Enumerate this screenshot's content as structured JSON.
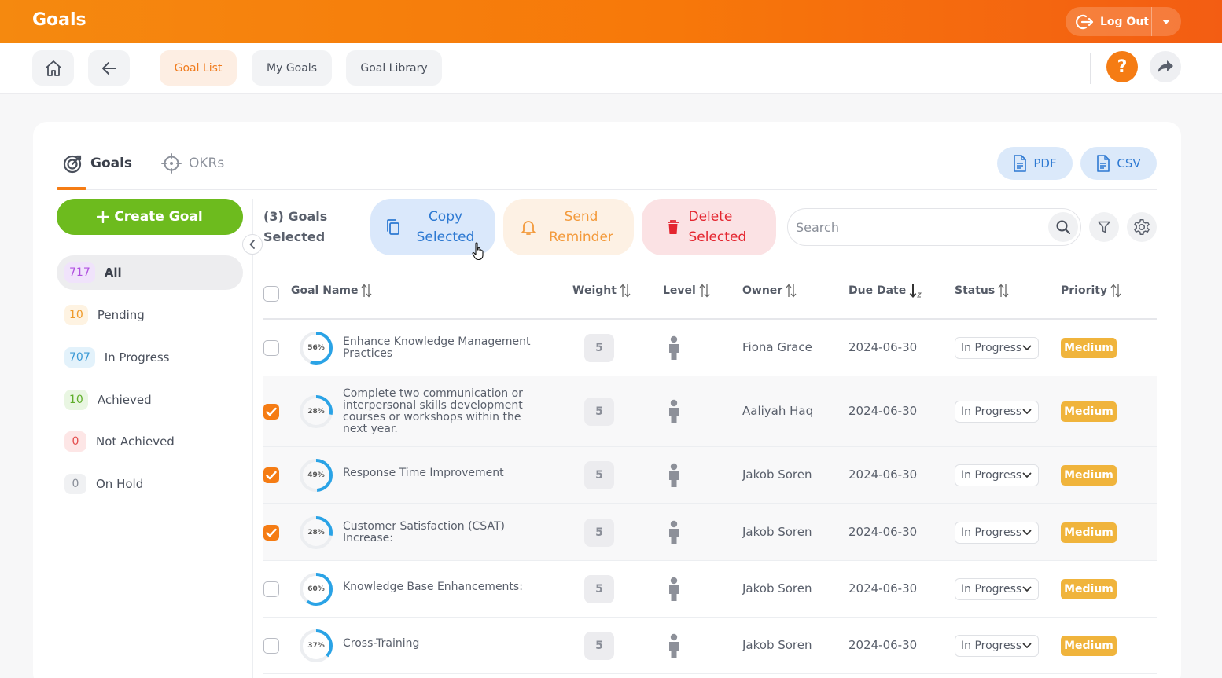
{
  "header": {
    "title": "Goals",
    "logout_label": "Log Out"
  },
  "nav": {
    "tabs": [
      {
        "label": "Goal List",
        "active": true
      },
      {
        "label": "My Goals",
        "active": false
      },
      {
        "label": "Goal Library",
        "active": false
      }
    ],
    "help_glyph": "?"
  },
  "view_tabs": [
    {
      "label": "Goals",
      "icon": "target-icon",
      "active": true
    },
    {
      "label": "OKRs",
      "icon": "crosshair-icon",
      "active": false
    }
  ],
  "exports": {
    "pdf_label": "PDF",
    "csv_label": "CSV"
  },
  "sidebar": {
    "create_label": "Create Goal",
    "filters": [
      {
        "count": "717",
        "label": "All",
        "active": true,
        "bg": "#f0e3fb",
        "fg": "#b04fe0"
      },
      {
        "count": "10",
        "label": "Pending",
        "active": false,
        "bg": "#fef3e2",
        "fg": "#ef9a2a"
      },
      {
        "count": "707",
        "label": "In Progress",
        "active": false,
        "bg": "#e3f2fb",
        "fg": "#3b9ad5"
      },
      {
        "count": "10",
        "label": "Achieved",
        "active": false,
        "bg": "#e9f6e2",
        "fg": "#5fae2a"
      },
      {
        "count": "0",
        "label": "Not Achieved",
        "active": false,
        "bg": "#fde6e6",
        "fg": "#e44d4d"
      },
      {
        "count": "0",
        "label": "On Hold",
        "active": false,
        "bg": "#f0f1f3",
        "fg": "#8a8f99"
      }
    ]
  },
  "toolbar": {
    "selected_count": "(3) Goals Selected",
    "copy_label": "Copy Selected",
    "reminder_label": "Send Reminder",
    "delete_label": "Delete Selected",
    "search_placeholder": "Search"
  },
  "table": {
    "columns": [
      "Goal Name",
      "Weight",
      "Level",
      "Owner",
      "Due Date",
      "Status",
      "Priority"
    ],
    "rows": [
      {
        "checked": false,
        "progress": 56,
        "progress_label": "56%",
        "name": "Enhance Knowledge Management Practices",
        "weight": "5",
        "owner": "Fiona Grace",
        "due": "2024-06-30",
        "status": "In Progress",
        "priority": "Medium"
      },
      {
        "checked": true,
        "progress": 28,
        "progress_label": "28%",
        "name": "Complete two communication or interpersonal skills development courses or workshops within the next year.",
        "weight": "5",
        "owner": "Aaliyah Haq",
        "due": "2024-06-30",
        "status": "In Progress",
        "priority": "Medium"
      },
      {
        "checked": true,
        "progress": 49,
        "progress_label": "49%",
        "name": "Response Time Improvement",
        "weight": "5",
        "owner": "Jakob Soren",
        "due": "2024-06-30",
        "status": "In Progress",
        "priority": "Medium"
      },
      {
        "checked": true,
        "progress": 28,
        "progress_label": "28%",
        "name": "Customer Satisfaction (CSAT) Increase:",
        "weight": "5",
        "owner": "Jakob Soren",
        "due": "2024-06-30",
        "status": "In Progress",
        "priority": "Medium"
      },
      {
        "checked": false,
        "progress": 60,
        "progress_label": "60%",
        "name": "Knowledge Base Enhancements:",
        "weight": "5",
        "owner": "Jakob Soren",
        "due": "2024-06-30",
        "status": "In Progress",
        "priority": "Medium"
      },
      {
        "checked": false,
        "progress": 37,
        "progress_label": "37%",
        "name": "Cross-Training",
        "weight": "5",
        "owner": "Jakob Soren",
        "due": "2024-06-30",
        "status": "In Progress",
        "priority": "Medium"
      }
    ]
  },
  "colors": {
    "accent": "#f57c14",
    "ring": "#2aa3e6",
    "priority_medium": "#f0b43c"
  }
}
